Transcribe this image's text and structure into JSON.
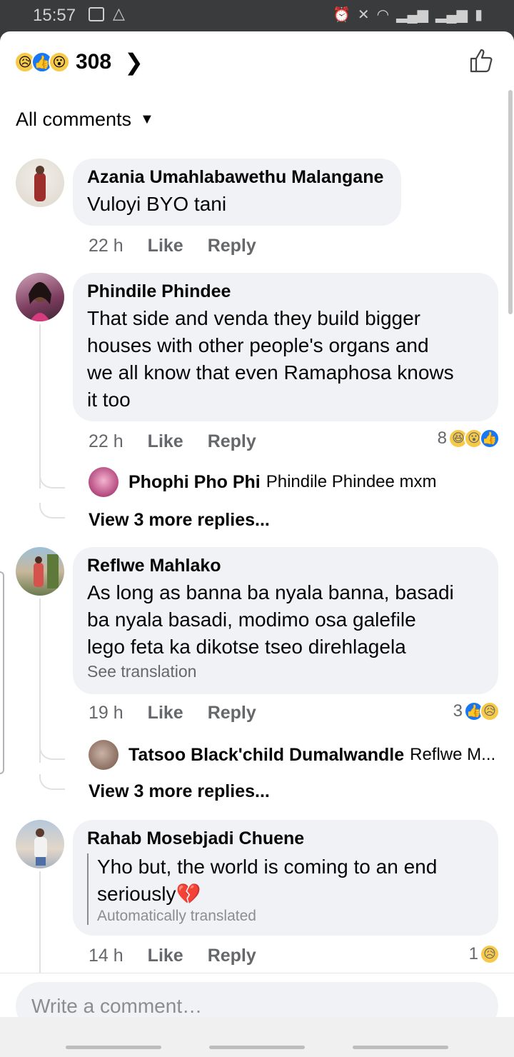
{
  "status_bar": {
    "time": "15:57"
  },
  "header": {
    "reaction_count": "308"
  },
  "filter": {
    "label": "All comments"
  },
  "comments": [
    {
      "author": "Azania Umahlabawethu Malangane",
      "text": "Vuloyi BYO tani",
      "time": "22 h",
      "like_label": "Like",
      "reply_label": "Reply"
    },
    {
      "author": "Phindile Phindee",
      "text_lines": [
        "That side and venda they build bigger",
        "houses with other people's organs and",
        "we all know that even Ramaphosa knows",
        "it too"
      ],
      "time": "22 h",
      "like_label": "Like",
      "reply_label": "Reply",
      "reaction_count": "8",
      "reply_preview": {
        "author": "Phophi Pho Phi",
        "text": "Phindile Phindee mxm"
      },
      "view_more": "View 3 more replies..."
    },
    {
      "author": "Reflwe Mahlako",
      "text_lines": [
        "As long as banna ba nyala banna, basadi",
        "ba nyala basadi, modimo osa galefile",
        "lego feta ka dikotse tseo direhlagela"
      ],
      "see_translation": "See translation",
      "time": "19 h",
      "like_label": "Like",
      "reply_label": "Reply",
      "reaction_count": "3",
      "reply_preview": {
        "author": "Tatsoo Black'child Dumalwandle",
        "text": "Reflwe M..."
      },
      "view_more": "View 3 more replies..."
    },
    {
      "author": "Rahab Mosebjadi Chuene",
      "text_lines": [
        "Yho but, the world is coming to an end",
        "seriously💔"
      ],
      "auto_translated": "Automatically translated",
      "time": "14 h",
      "like_label": "Like",
      "reply_label": "Reply",
      "reaction_count": "1"
    }
  ],
  "composer": {
    "placeholder": "Write a comment…"
  },
  "icons": {
    "reactions_header": [
      "sad-icon",
      "like-icon",
      "wow-icon"
    ],
    "comment2_reactions": [
      "haha-icon",
      "wow-icon",
      "like-icon"
    ],
    "comment3_reactions": [
      "like-icon",
      "sad-icon"
    ],
    "comment4_reactions": [
      "sad-icon"
    ]
  },
  "colors": {
    "like_blue": "#1877f2",
    "bubble_bg": "#f0f2f5",
    "meta_gray": "#65676b"
  }
}
